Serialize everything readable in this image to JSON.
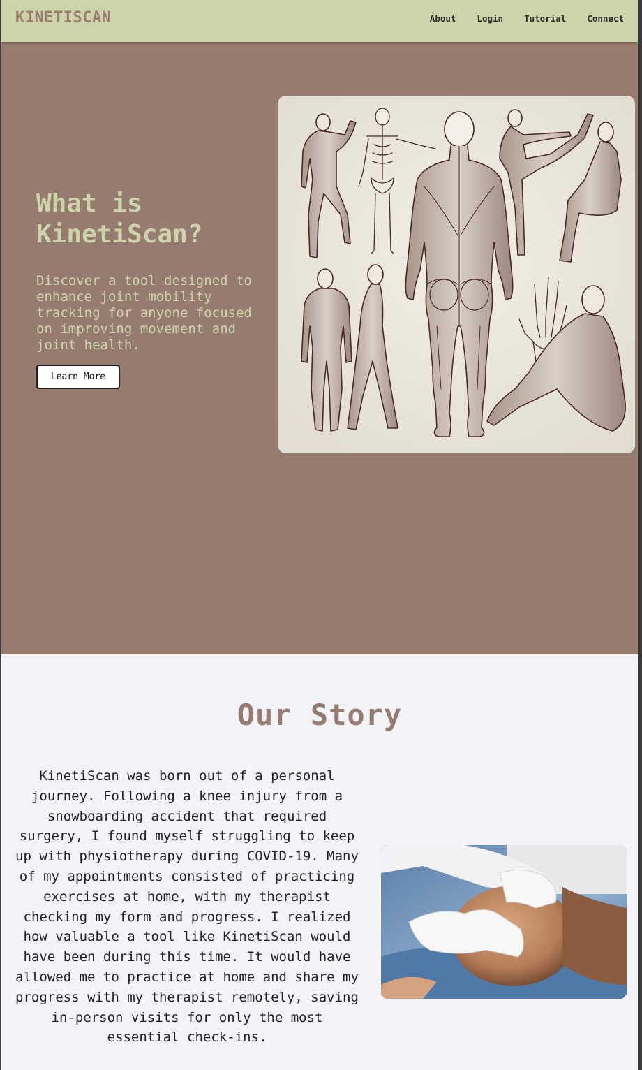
{
  "nav": {
    "brand": "KINETISCAN",
    "links": [
      "About",
      "Login",
      "Tutorial",
      "Connect"
    ]
  },
  "hero": {
    "title": "What is KinetiScan?",
    "description": "Discover a tool designed to enhance joint mobility tracking for anyone focused on improving movement and joint health.",
    "button_label": "Learn More",
    "illustration": "anatomical-figures-illustration"
  },
  "story": {
    "title": "Our Story",
    "text": "KinetiScan was born out of a personal journey. Following a knee injury from a snowboarding accident that required surgery, I found myself struggling to keep up with physiotherapy during COVID-19. Many of my appointments consisted of practicing exercises at home, with my therapist checking my form and progress. I realized how valuable a tool like KinetiScan would have been during this time. It would have allowed me to practice at home and share my progress with my therapist remotely, saving in-person visits for only the most essential check-ins.",
    "photo": "knee-examination-photo"
  },
  "colors": {
    "nav_bg": "#cdd4aa",
    "brand": "#9a7d70",
    "hero_bg": "#967c70",
    "hero_text": "#cdd4aa",
    "story_bg": "#f4f3f8",
    "story_title": "#967c70"
  }
}
